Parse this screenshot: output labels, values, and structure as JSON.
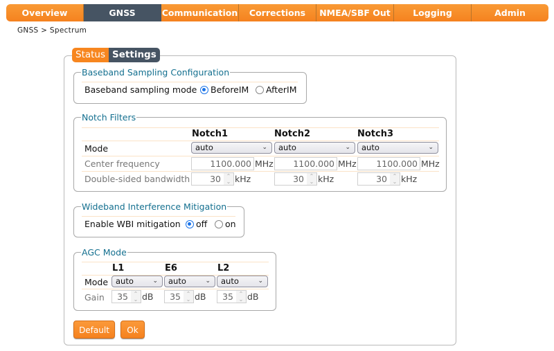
{
  "nav": {
    "tabs": [
      {
        "label": "Overview",
        "active": false
      },
      {
        "label": "GNSS",
        "active": true
      },
      {
        "label": "Communication",
        "active": false
      },
      {
        "label": "Corrections",
        "active": false
      },
      {
        "label": "NMEA/SBF Out",
        "active": false
      },
      {
        "label": "Logging",
        "active": false
      },
      {
        "label": "Admin",
        "active": false
      }
    ]
  },
  "breadcrumb": "GNSS > Spectrum",
  "subtabs": {
    "status": "Status",
    "settings": "Settings",
    "active": "Settings"
  },
  "baseband": {
    "legend": "Baseband Sampling Configuration",
    "label": "Baseband sampling mode",
    "options": [
      "BeforeIM",
      "AfterIM"
    ],
    "selected": "BeforeIM"
  },
  "notch": {
    "legend": "Notch Filters",
    "columns": [
      "Notch1",
      "Notch2",
      "Notch3"
    ],
    "row_labels": {
      "mode": "Mode",
      "center": "Center frequency",
      "bandwidth": "Double-sided bandwidth"
    },
    "modes": [
      "auto",
      "auto",
      "auto"
    ],
    "center_frequencies": [
      "1100.000",
      "1100.000",
      "1100.000"
    ],
    "center_unit": "MHz",
    "bandwidths": [
      "30",
      "30",
      "30"
    ],
    "bandwidth_unit": "kHz"
  },
  "wbi": {
    "legend": "Wideband Interference Mitigation",
    "label": "Enable WBI mitigation",
    "options": [
      "off",
      "on"
    ],
    "selected": "off"
  },
  "agc": {
    "legend": "AGC Mode",
    "columns": [
      "L1",
      "E6",
      "L2"
    ],
    "row_labels": {
      "mode": "Mode",
      "gain": "Gain"
    },
    "modes": [
      "auto",
      "auto",
      "auto"
    ],
    "gains": [
      "35",
      "35",
      "35"
    ],
    "gain_unit": "dB"
  },
  "buttons": {
    "default": "Default",
    "ok": "Ok"
  },
  "colors": {
    "accent": "#f5821f",
    "active_tab": "#465463",
    "legend": "#136f8f"
  }
}
